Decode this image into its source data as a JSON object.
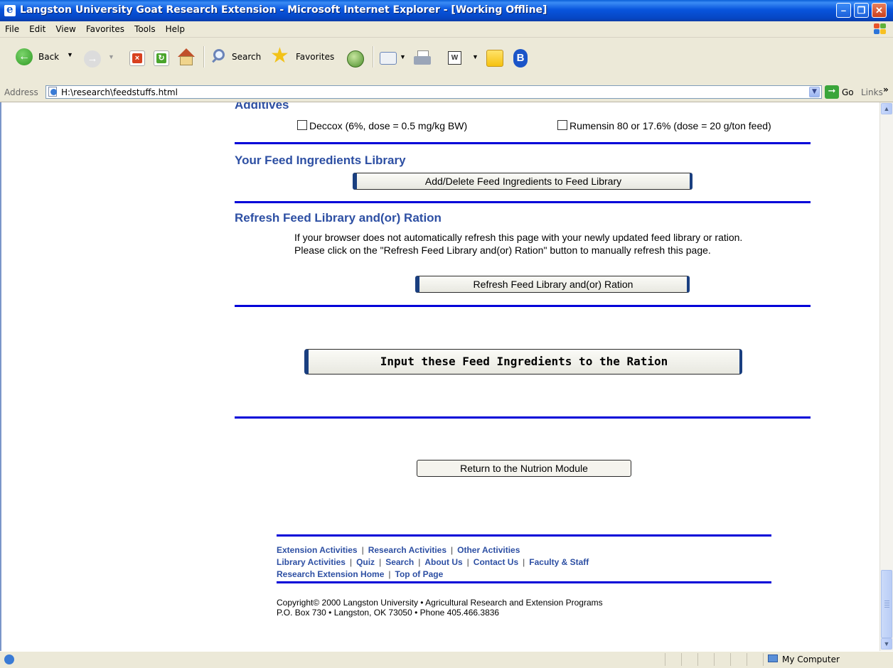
{
  "window": {
    "title": "Langston University Goat Research Extension - Microsoft Internet Explorer - [Working Offline]",
    "minimize": "–",
    "maximize": "❐",
    "close": "✕"
  },
  "menu": [
    "File",
    "Edit",
    "View",
    "Favorites",
    "Tools",
    "Help"
  ],
  "toolbar": {
    "back_label": "Back",
    "search_label": "Search",
    "favorites_label": "Favorites"
  },
  "address": {
    "label": "Address",
    "url": "H:\\research\\feedstuffs.html",
    "go_label": "Go",
    "links_label": "Links",
    "chevron": "»"
  },
  "page": {
    "additives_title": "Additives",
    "deccox_label": "Deccox (6%, dose = 0.5 mg/kg BW)",
    "rumensin_label": "Rumensin 80 or 17.6% (dose = 20 g/ton feed)",
    "library_title": "Your Feed Ingredients Library",
    "add_delete_button": "Add/Delete Feed Ingredients to Feed Library",
    "refresh_title": "Refresh Feed Library and(or) Ration",
    "refresh_text_1": "If your browser does not automatically refresh this page with your newly updated feed library or ration.",
    "refresh_text_2": "Please click on the \"Refresh Feed Library and(or) Ration\" button to manually refresh this page.",
    "refresh_button": "Refresh Feed Library and(or) Ration",
    "input_button": "Input these Feed Ingredients to the Ration",
    "return_button": "Return to the Nutrion Module"
  },
  "footer": {
    "row1": [
      "Extension Activities",
      "Research Activities",
      "Other Activities"
    ],
    "row2": [
      "Library Activities",
      "Quiz",
      "Search",
      "About Us",
      "Contact Us",
      "Faculty & Staff"
    ],
    "row3": [
      "Research Extension Home",
      "Top of Page"
    ],
    "separator": "|",
    "copyright": "Copyright© 2000 Langston University  • Agricultural Research and Extension Programs",
    "address": "P.O. Box 730  • Langston, OK  73050 • Phone 405.466.3836"
  },
  "status": {
    "zone": "My Computer"
  },
  "colors": {
    "heading": "#2d4fa3",
    "rule": "#0000d8"
  }
}
